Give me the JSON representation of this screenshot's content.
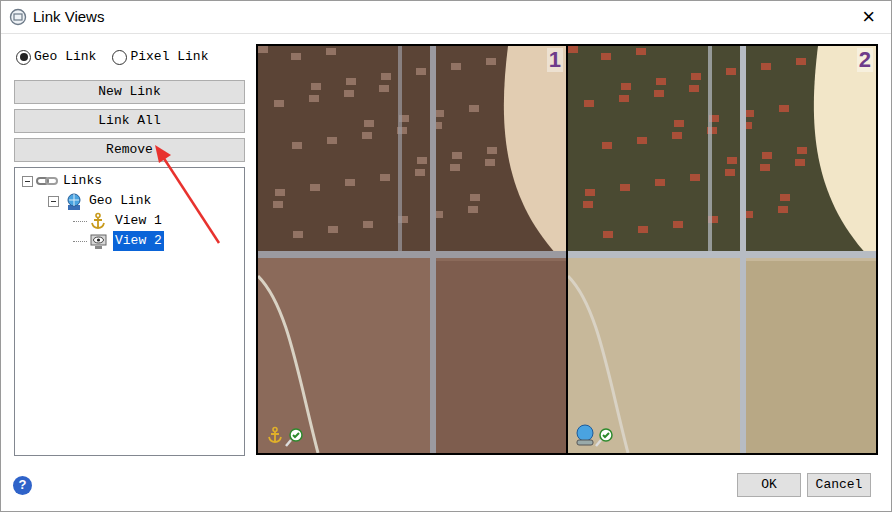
{
  "window": {
    "title": "Link Views",
    "close": "×"
  },
  "link_modes": [
    {
      "label": "Geo Link",
      "selected": true
    },
    {
      "label": "Pixel Link",
      "selected": false
    }
  ],
  "buttons": [
    "New Link",
    "Link All",
    "Remove"
  ],
  "tree": {
    "root": {
      "label": "Links",
      "expanded": true
    },
    "groups": [
      {
        "label": "Geo Link",
        "expanded": true,
        "views": [
          {
            "label": "View 1",
            "kind": "anchor",
            "selected": false
          },
          {
            "label": "View 2",
            "kind": "linked",
            "selected": true
          }
        ]
      }
    ]
  },
  "views": [
    {
      "number": "1",
      "kind": "anchor"
    },
    {
      "number": "2",
      "kind": "linked"
    }
  ],
  "help": "?",
  "dialog_buttons": [
    "OK",
    "Cancel"
  ]
}
